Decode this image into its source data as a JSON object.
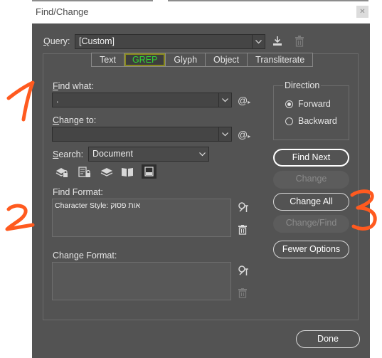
{
  "window": {
    "title": "Find/Change"
  },
  "query": {
    "label": "Query:",
    "value": "[Custom]"
  },
  "tabs": [
    {
      "label": "Text"
    },
    {
      "label": "GREP",
      "active": true
    },
    {
      "label": "Glyph"
    },
    {
      "label": "Object"
    },
    {
      "label": "Transliterate"
    }
  ],
  "find_what": {
    "label": "Find what:",
    "value": "."
  },
  "change_to": {
    "label": "Change to:",
    "value": ""
  },
  "search": {
    "label": "Search:",
    "value": "Document"
  },
  "find_format": {
    "label": "Find Format:",
    "value": "Character Style: אות פסוק"
  },
  "change_format": {
    "label": "Change Format:",
    "value": ""
  },
  "direction": {
    "label": "Direction",
    "options": [
      "Forward",
      "Backward"
    ],
    "selected": "Forward"
  },
  "buttons": {
    "find_next": "Find Next",
    "change": "Change",
    "change_all": "Change All",
    "change_find": "Change/Find",
    "fewer_options": "Fewer Options",
    "done": "Done"
  },
  "annotations": [
    "1",
    "2",
    "3"
  ],
  "colors": {
    "dialog_bg": "#535353",
    "active_tab_text": "#33d633",
    "annotation": "#ff5a1f"
  },
  "icons": [
    "save-query-icon",
    "delete-query-icon",
    "special-characters-icon",
    "include-locked-layers-icon",
    "include-locked-stories-icon",
    "include-hidden-layers-icon",
    "include-master-pages-icon",
    "include-footnotes-icon",
    "specify-format-icon",
    "clear-format-icon"
  ]
}
